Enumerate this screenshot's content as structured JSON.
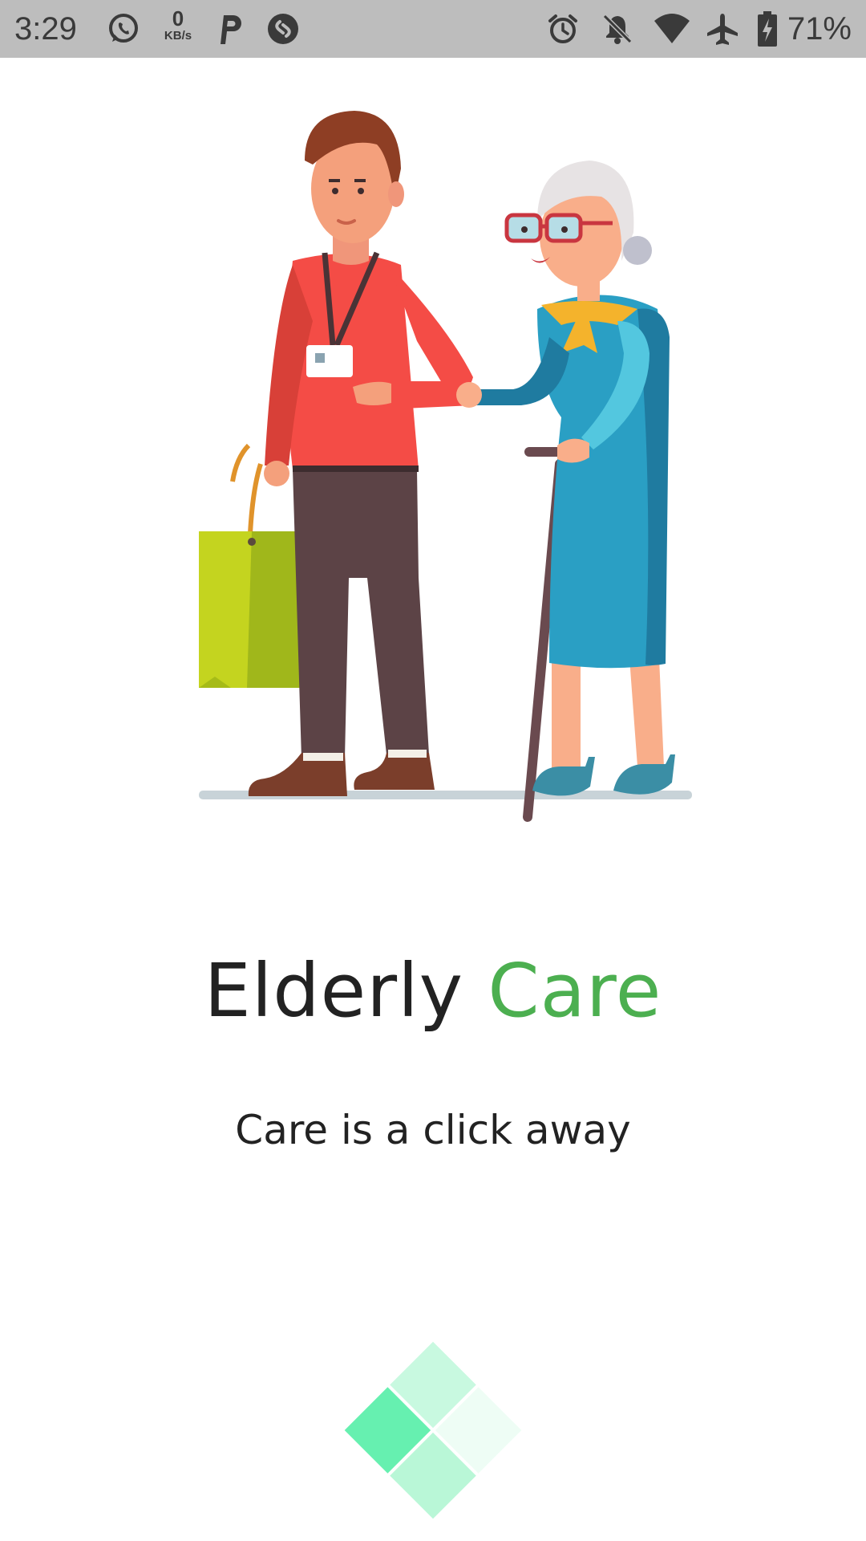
{
  "status_bar": {
    "time": "3:29",
    "net_speed_value": "0",
    "net_speed_unit": "KB/s",
    "battery_percent": "71%",
    "icons": [
      "whatsapp-icon",
      "parking-icon",
      "shazam-icon",
      "alarm-icon",
      "notifications-off-icon",
      "wifi-icon",
      "airplane-mode-icon",
      "battery-charging-icon"
    ]
  },
  "splash": {
    "title_part1": "Elderly ",
    "title_part2": "Care",
    "subtitle": "Care is a click away"
  },
  "colors": {
    "status_bar_bg": "#bdbdbd",
    "accent_green": "#4caf50",
    "text_dark": "#222222",
    "loader_green": "#66f0b0"
  }
}
